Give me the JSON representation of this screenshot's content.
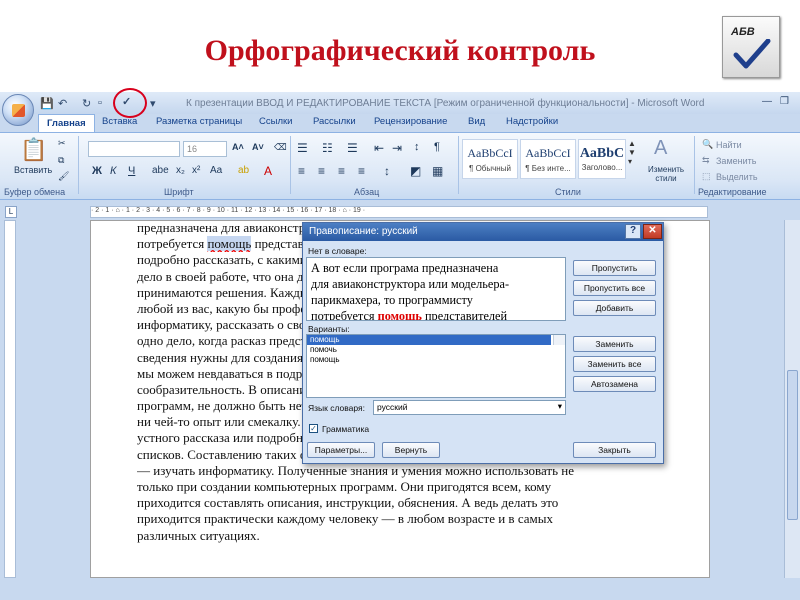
{
  "slide": {
    "title": "Орфографический контроль",
    "icon_text": "АБВ"
  },
  "window": {
    "title": "К презентации ВВОД И РЕДАКТИРОВАНИЕ ТЕКСТА [Режим ограниченной функциональности] - Microsoft Word"
  },
  "tabs": [
    "Главная",
    "Вставка",
    "Разметка страницы",
    "Ссылки",
    "Рассылки",
    "Рецензирование",
    "Вид",
    "Надстройки"
  ],
  "ribbon": {
    "paste_label": "Вставить",
    "clipboard_label": "Буфер обмена",
    "font_label": "Шрифт",
    "paragraph_label": "Абзац",
    "styles_label": "Стили",
    "editing_label": "Редактирование",
    "font_size": "16",
    "styles": [
      {
        "sample": "AaBbCcI",
        "name": "¶ Обычный"
      },
      {
        "sample": "AaBbCcI",
        "name": "¶ Без инте..."
      },
      {
        "sample": "AaBbC",
        "name": "Заголово..."
      }
    ],
    "change_styles": "Изменить стили",
    "find": "Найти",
    "replace": "Заменить",
    "select": "Выделить"
  },
  "document": {
    "lines": [
      "предназначена для авиаконструктора или модельера-парикмахера, то программисту",
      "потребуется помощь представителей этих профессий. Им нужно будет",
      "подробно рассказать, с какими задачами они сталкиваются, как в целом устроено",
      "дело в своей работе, что она должна делать, какими мотивами, на основании чего",
      "принимаются решения. Каждый из нас может стать программистом, если сумеет",
      "любой из вас, какую бы профессию он не выбрал, хорошо знать",
      "информатику, рассказать о своей профессии. Ведь объяснить — это",
      "одно дело, когда расказ представителя профессии нужен другим. Эти",
      "сведения нужны для создания компьютерных программ. Мы с вами сами",
      "мы можем невдаваться в подробности, проявлять творчество,",
      "сообразительность. В описании правил для компьютерных",
      "программ, не должно быть неточностей, не должно быть пропущено",
      "ни чей-то опыт или смекалку. Поэтому умение изложить правила —",
      "устного рассказа или подробного описания, инструкций,",
      "списков. Составлению таких описаний, алгоритмов и помогает",
      "— изучать информатику. Полученные знания и умения можно использовать не",
      "только при создании компьютерных программ. Они пригодятся всем, кому",
      "приходится составлять описания, инструкции, обяснения. А ведь делать это",
      "приходится практически каждому человеку — в любом возрасте и в самых",
      "различных ситуациях."
    ]
  },
  "dialog": {
    "title": "Правописание: русский",
    "not_in_dict_label": "Нет в словаре:",
    "not_in_dict_text_1": "А вот если програма предназначена",
    "not_in_dict_text_2": "для авиаконструктора или модельера-",
    "not_in_dict_text_3": "парикмахера, то программисту",
    "not_in_dict_text_4a": "потребуется ",
    "not_in_dict_error": "помощь",
    "not_in_dict_text_4b": " представителей",
    "variants_label": "Варианты:",
    "variants": [
      "помощь",
      "помочь",
      "помощь"
    ],
    "lang_label": "Язык словаря:",
    "lang_value": "русский",
    "grammar_label": "Грамматика",
    "btn_skip": "Пропустить",
    "btn_skip_all": "Пропустить все",
    "btn_add": "Добавить",
    "btn_replace": "Заменить",
    "btn_replace_all": "Заменить все",
    "btn_autocorrect": "Автозамена",
    "btn_params": "Параметры...",
    "btn_undo": "Вернуть",
    "btn_close": "Закрыть"
  }
}
